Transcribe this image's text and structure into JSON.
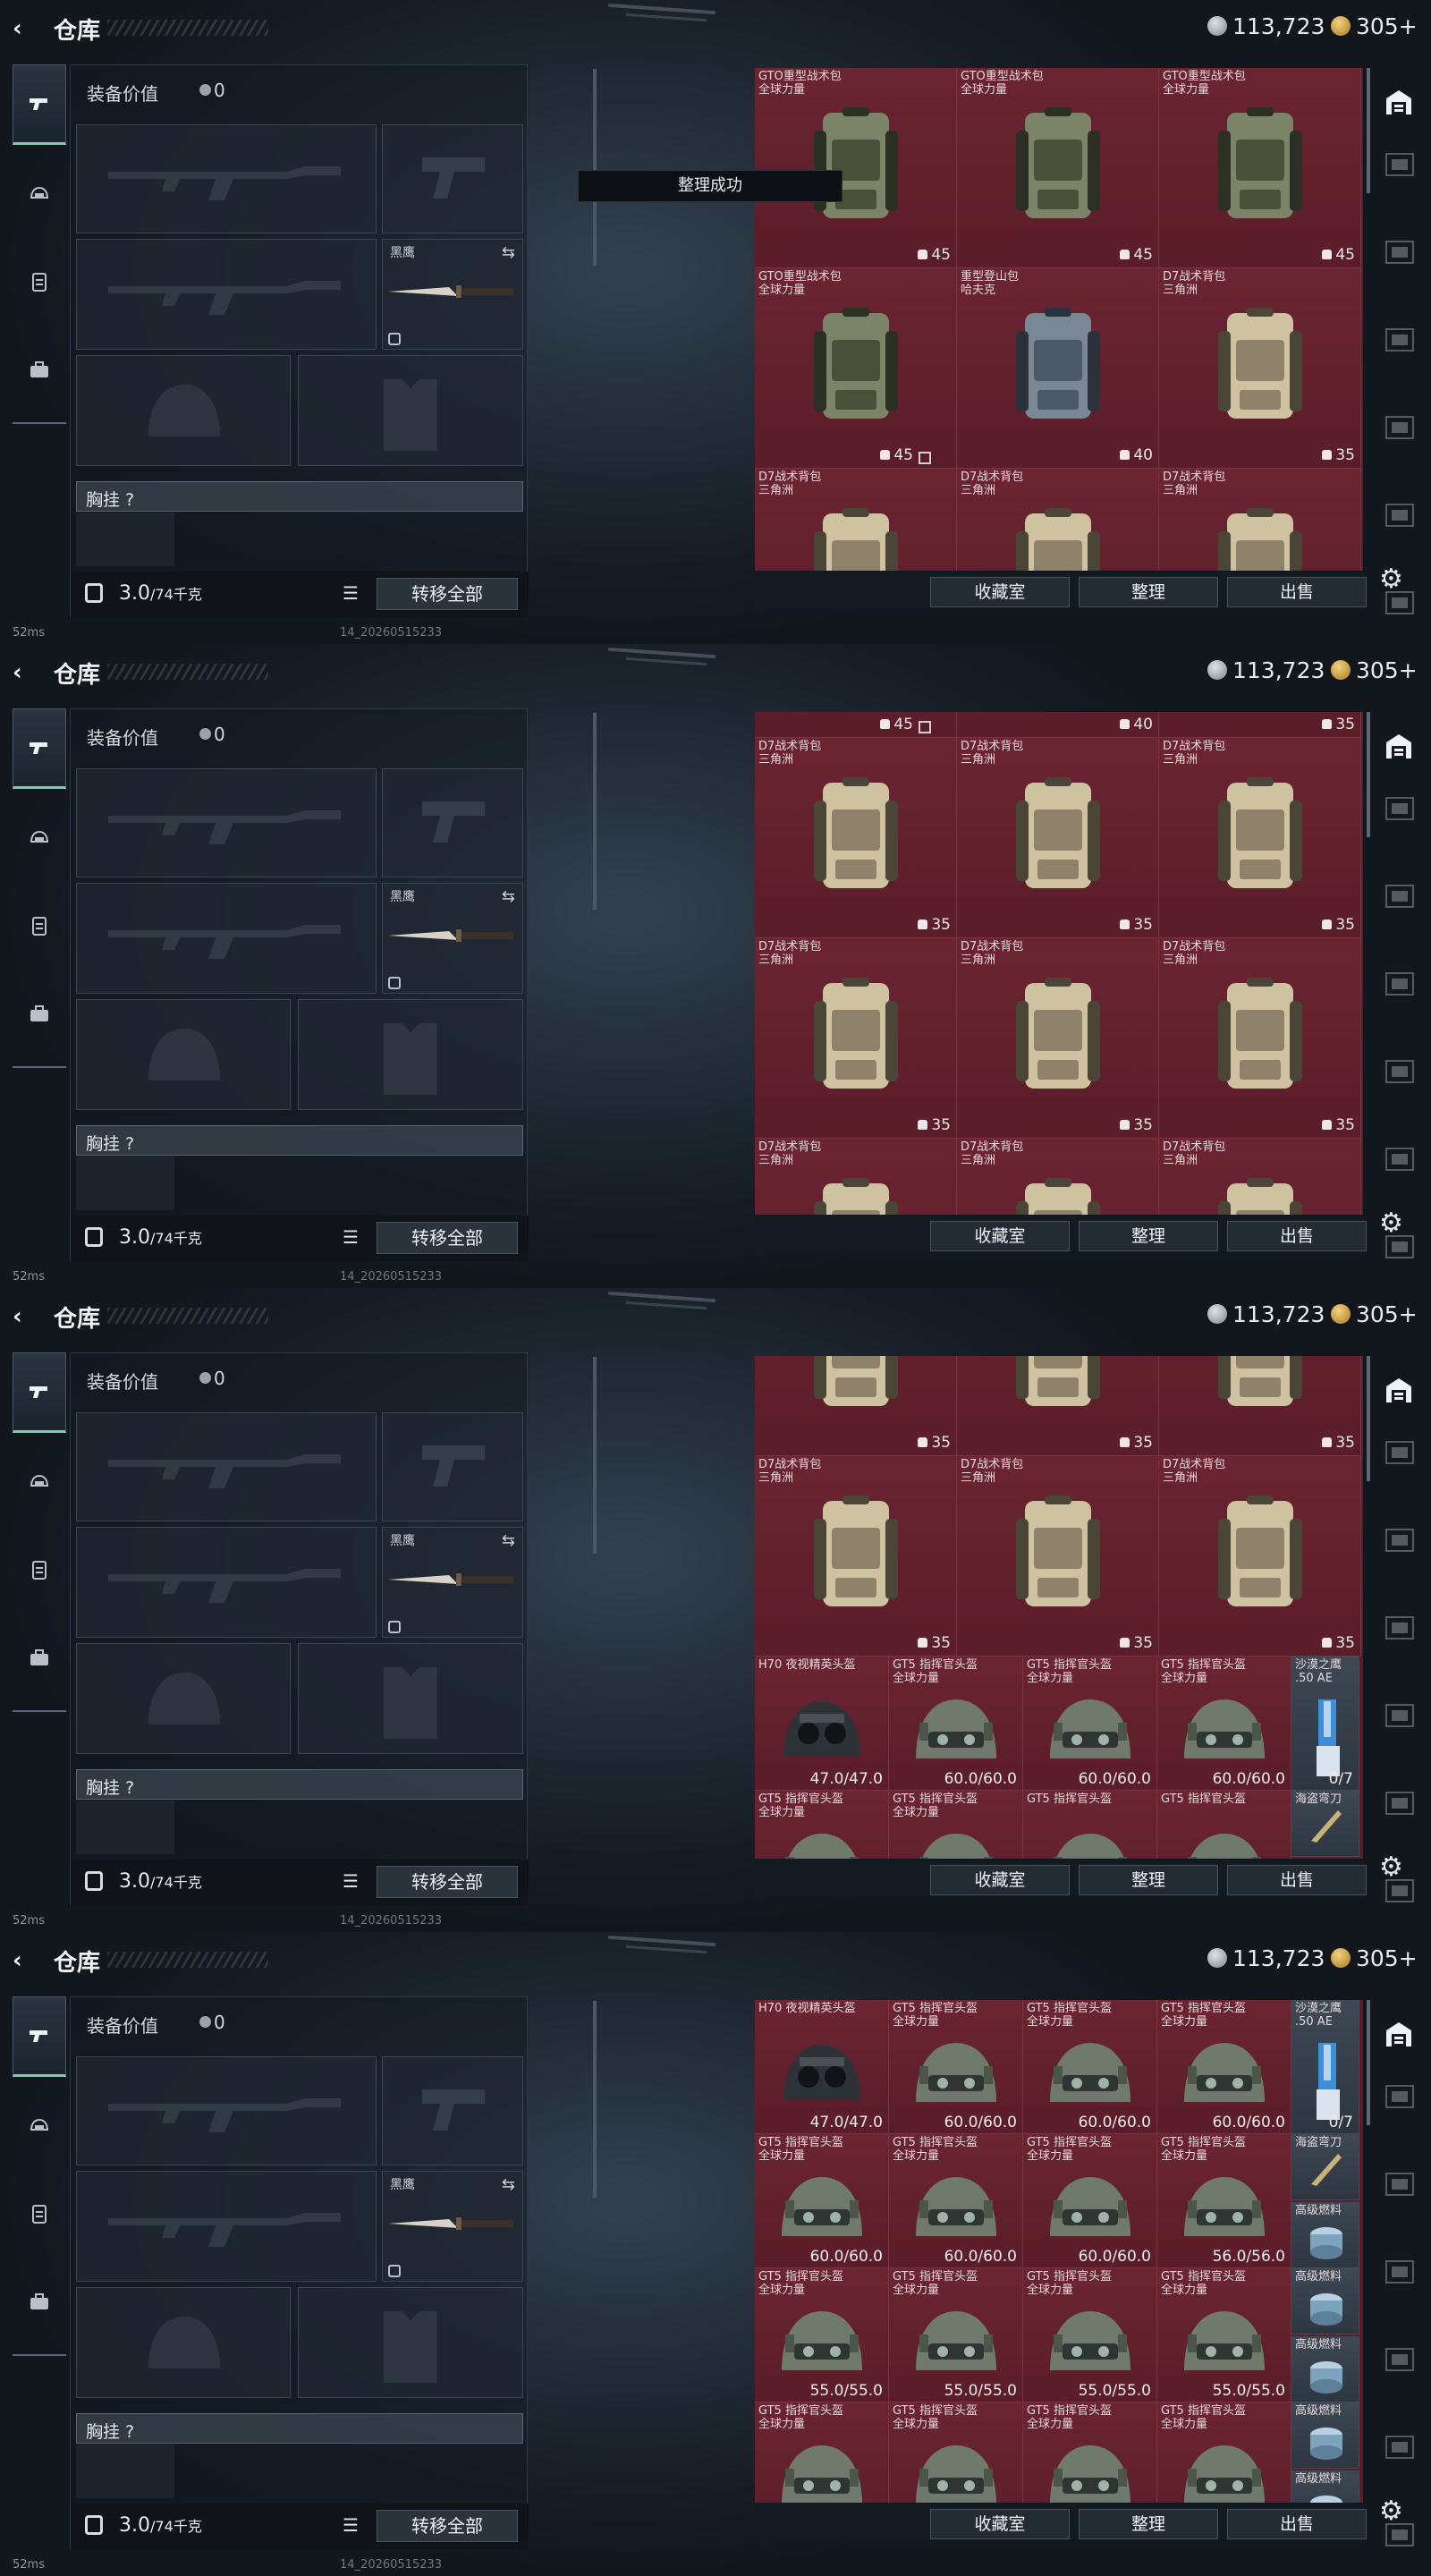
{
  "header": {
    "title": "仓库",
    "currency1": "113,723",
    "currency2": "305+"
  },
  "equipment": {
    "value_label": "装备价值",
    "value": "0",
    "knife_name": "黑鹰",
    "chest_label": "胸挂 ?",
    "weight": "3.0",
    "weight_unit": "/74千克",
    "transfer_all": "转移全部"
  },
  "toast": "整理成功",
  "buttons": {
    "collection": "收藏室",
    "sort": "整理",
    "sell": "出售"
  },
  "status": {
    "ping": "52ms",
    "build": "14_20260515233"
  },
  "screens": [
    {
      "rows": [
        {
          "kind": "bag",
          "cells": [
            {
              "name": "GTO重型战术包",
              "sub": "全球力量",
              "cap": "45",
              "color": "green"
            },
            {
              "name": "GTO重型战术包",
              "sub": "全球力量",
              "cap": "45",
              "color": "green"
            },
            {
              "name": "GTO重型战术包",
              "sub": "全球力量",
              "cap": "45",
              "color": "green"
            }
          ]
        },
        {
          "kind": "bag",
          "cells": [
            {
              "name": "GTO重型战术包",
              "sub": "全球力量",
              "cap": "45",
              "color": "green",
              "nolock": true
            },
            {
              "name": "重型登山包",
              "sub": "哈夫克",
              "cap": "40",
              "color": "blue"
            },
            {
              "name": "D7战术背包",
              "sub": "三角洲",
              "cap": "35",
              "color": "tan"
            }
          ]
        },
        {
          "kind": "bag",
          "cells": [
            {
              "name": "D7战术背包",
              "sub": "三角洲",
              "cap": "35",
              "color": "tan"
            },
            {
              "name": "D7战术背包",
              "sub": "三角洲",
              "cap": "35",
              "color": "tan"
            },
            {
              "name": "D7战术背包",
              "sub": "三角洲",
              "cap": "35",
              "color": "tan"
            }
          ]
        }
      ],
      "offset": 0,
      "toast": true
    },
    {
      "rows": [
        {
          "kind": "bag",
          "cells": [
            {
              "name": "",
              "sub": "",
              "cap": "45",
              "color": "green",
              "nolock": true
            },
            {
              "name": "",
              "sub": "",
              "cap": "40",
              "color": "blue"
            },
            {
              "name": "",
              "sub": "",
              "cap": "35",
              "color": "tan"
            }
          ]
        },
        {
          "kind": "bag",
          "cells": [
            {
              "name": "D7战术背包",
              "sub": "三角洲",
              "cap": "35",
              "color": "tan"
            },
            {
              "name": "D7战术背包",
              "sub": "三角洲",
              "cap": "35",
              "color": "tan"
            },
            {
              "name": "D7战术背包",
              "sub": "三角洲",
              "cap": "35",
              "color": "tan"
            }
          ]
        },
        {
          "kind": "bag",
          "cells": [
            {
              "name": "D7战术背包",
              "sub": "三角洲",
              "cap": "35",
              "color": "tan"
            },
            {
              "name": "D7战术背包",
              "sub": "三角洲",
              "cap": "35",
              "color": "tan"
            },
            {
              "name": "D7战术背包",
              "sub": "三角洲",
              "cap": "35",
              "color": "tan"
            }
          ]
        },
        {
          "kind": "bag",
          "cells": [
            {
              "name": "D7战术背包",
              "sub": "三角洲",
              "cap": "",
              "color": "tan"
            },
            {
              "name": "D7战术背包",
              "sub": "三角洲",
              "cap": "",
              "color": "tan"
            },
            {
              "name": "D7战术背包",
              "sub": "三角洲",
              "cap": "",
              "color": "tan"
            }
          ]
        }
      ],
      "offset": -195,
      "toast": false
    },
    {
      "rows": [
        {
          "kind": "bag",
          "cells": [
            {
              "name": "",
              "sub": "",
              "cap": "35",
              "color": "tan"
            },
            {
              "name": "",
              "sub": "",
              "cap": "35",
              "color": "tan"
            },
            {
              "name": "",
              "sub": "",
              "cap": "35",
              "color": "tan"
            }
          ]
        },
        {
          "kind": "bag",
          "cells": [
            {
              "name": "D7战术背包",
              "sub": "三角洲",
              "cap": "35",
              "color": "tan"
            },
            {
              "name": "D7战术背包",
              "sub": "三角洲",
              "cap": "35",
              "color": "tan"
            },
            {
              "name": "D7战术背包",
              "sub": "三角洲",
              "cap": "35",
              "color": "tan"
            }
          ]
        },
        {
          "kind": "helm",
          "cells": [
            {
              "name": "H70 夜视精英头盔",
              "sub": "",
              "dur": "47.0/47.0",
              "type": "nv"
            },
            {
              "name": "GT5 指挥官头盔",
              "sub": "全球力量",
              "dur": "60.0/60.0",
              "type": "gt"
            },
            {
              "name": "GT5 指挥官头盔",
              "sub": "全球力量",
              "dur": "60.0/60.0",
              "type": "gt"
            },
            {
              "name": "GT5 指挥官头盔",
              "sub": "全球力量",
              "dur": "60.0/60.0",
              "type": "gt"
            },
            {
              "name": "沙漠之鹰",
              "sub": ".50 AE",
              "dur": "0/7",
              "type": "pistol"
            }
          ]
        },
        {
          "kind": "helm",
          "cells": [
            {
              "name": "GT5 指挥官头盔",
              "sub": "全球力量",
              "dur": "",
              "type": "gt"
            },
            {
              "name": "GT5 指挥官头盔",
              "sub": "全球力量",
              "dur": "",
              "type": "gt"
            },
            {
              "name": "GT5 指挥官头盔",
              "sub": "",
              "dur": "",
              "type": "gt"
            },
            {
              "name": "GT5 指挥官头盔",
              "sub": "",
              "dur": "",
              "type": "gt"
            },
            {
              "name": "海盗弯刀",
              "sub": "",
              "dur": "",
              "type": "blade"
            }
          ]
        }
      ],
      "offset": -112,
      "toast": false
    },
    {
      "rows": [
        {
          "kind": "helm",
          "cells": [
            {
              "name": "H70 夜视精英头盔",
              "sub": "",
              "dur": "47.0/47.0",
              "type": "nv"
            },
            {
              "name": "GT5 指挥官头盔",
              "sub": "全球力量",
              "dur": "60.0/60.0",
              "type": "gt"
            },
            {
              "name": "GT5 指挥官头盔",
              "sub": "全球力量",
              "dur": "60.0/60.0",
              "type": "gt"
            },
            {
              "name": "GT5 指挥官头盔",
              "sub": "全球力量",
              "dur": "60.0/60.0",
              "type": "gt"
            },
            {
              "name": "沙漠之鹰",
              "sub": ".50 AE",
              "dur": "0/7",
              "type": "pistol"
            }
          ]
        },
        {
          "kind": "helm",
          "cells": [
            {
              "name": "GT5 指挥官头盔",
              "sub": "全球力量",
              "dur": "60.0/60.0",
              "type": "gt"
            },
            {
              "name": "GT5 指挥官头盔",
              "sub": "全球力量",
              "dur": "60.0/60.0",
              "type": "gt"
            },
            {
              "name": "GT5 指挥官头盔",
              "sub": "全球力量",
              "dur": "60.0/60.0",
              "type": "gt"
            },
            {
              "name": "GT5 指挥官头盔",
              "sub": "全球力量",
              "dur": "56.0/56.0",
              "type": "gt"
            },
            {
              "name": "海盗弯刀",
              "sub": "",
              "dur": "",
              "type": "blade"
            }
          ]
        },
        {
          "kind": "helm",
          "cells": [
            {
              "name": "GT5 指挥官头盔",
              "sub": "全球力量",
              "dur": "55.0/55.0",
              "type": "gt"
            },
            {
              "name": "GT5 指挥官头盔",
              "sub": "全球力量",
              "dur": "55.0/55.0",
              "type": "gt"
            },
            {
              "name": "GT5 指挥官头盔",
              "sub": "全球力量",
              "dur": "55.0/55.0",
              "type": "gt"
            },
            {
              "name": "GT5 指挥官头盔",
              "sub": "全球力量",
              "dur": "55.0/55.0",
              "type": "gt"
            },
            {
              "name": "高级燃料",
              "sub": "",
              "dur": "",
              "type": "fuel"
            }
          ]
        },
        {
          "kind": "helm",
          "cells": [
            {
              "name": "GT5 指挥官头盔",
              "sub": "全球力量",
              "dur": "",
              "type": "gt"
            },
            {
              "name": "GT5 指挥官头盔",
              "sub": "全球力量",
              "dur": "",
              "type": "gt"
            },
            {
              "name": "GT5 指挥官头盔",
              "sub": "全球力量",
              "dur": "",
              "type": "gt"
            },
            {
              "name": "GT5 指挥官头盔",
              "sub": "全球力量",
              "dur": "",
              "type": "gt"
            },
            {
              "name": "高级燃料",
              "sub": "",
              "dur": "",
              "type": "fuel"
            }
          ]
        }
      ],
      "offset": 0,
      "toast": false
    }
  ]
}
